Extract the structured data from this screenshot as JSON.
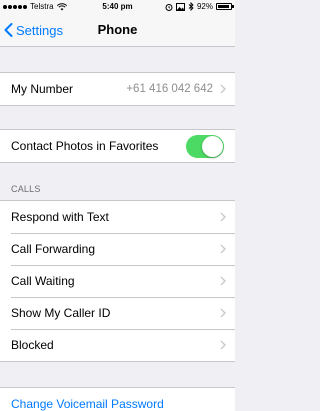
{
  "status_bar": {
    "carrier": "Telstra",
    "time": "5:40 pm",
    "battery_text": "92%",
    "battery_level": 0.92,
    "signal_bars": 5
  },
  "nav": {
    "back_label": "Settings",
    "title": "Phone"
  },
  "my_number": {
    "label": "My Number",
    "value": "+61 416 042 642"
  },
  "contact_photos": {
    "label": "Contact Photos in Favorites",
    "enabled": true
  },
  "calls_section": {
    "header": "CALLS",
    "items": [
      {
        "label": "Respond with Text"
      },
      {
        "label": "Call Forwarding"
      },
      {
        "label": "Call Waiting"
      },
      {
        "label": "Show My Caller ID"
      },
      {
        "label": "Blocked"
      }
    ]
  },
  "voicemail": {
    "label": "Change Voicemail Password"
  },
  "colors": {
    "accent": "#007aff",
    "toggle_on": "#4cd964",
    "background": "#efeff4"
  }
}
